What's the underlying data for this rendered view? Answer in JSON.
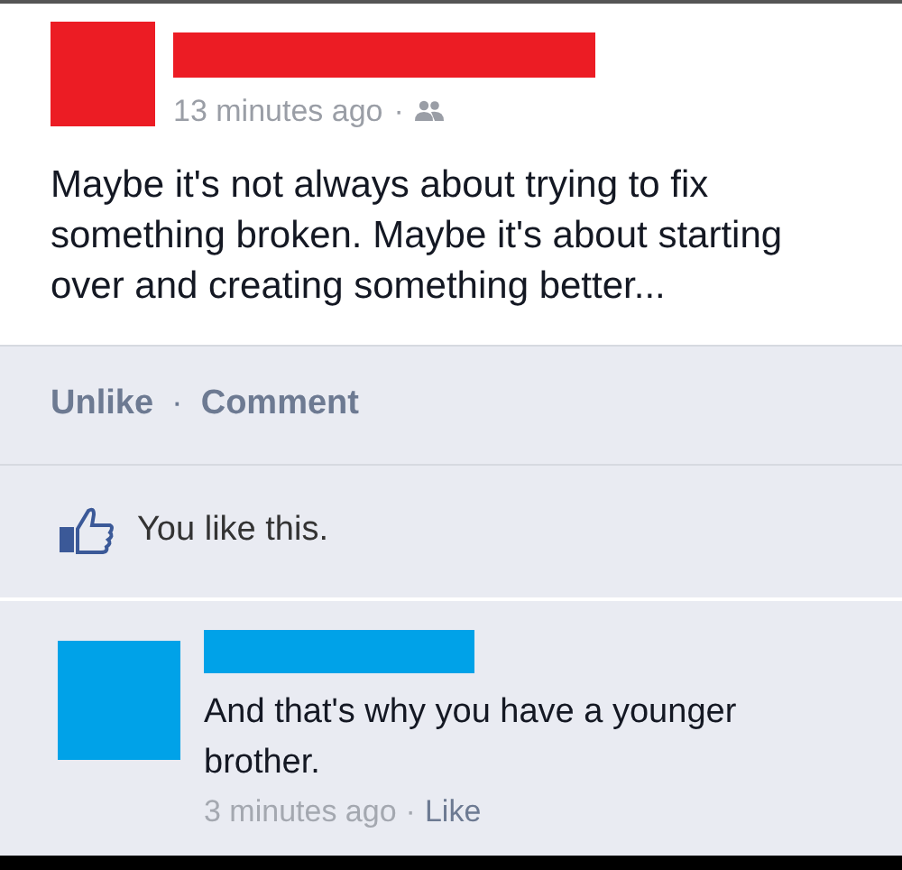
{
  "post": {
    "time": "13 minutes ago",
    "separator": "·",
    "text": "Maybe it's not always about trying to fix something broken. Maybe it's about starting over and creating something better..."
  },
  "actions": [
    {
      "label": "Unlike"
    },
    {
      "label": "Comment"
    }
  ],
  "action_separator": "·",
  "likes": {
    "text": "You like this."
  },
  "comment": {
    "text": "And that's why you have a younger brother.",
    "time": "3 minutes ago",
    "separator": "·",
    "like": "Like"
  }
}
